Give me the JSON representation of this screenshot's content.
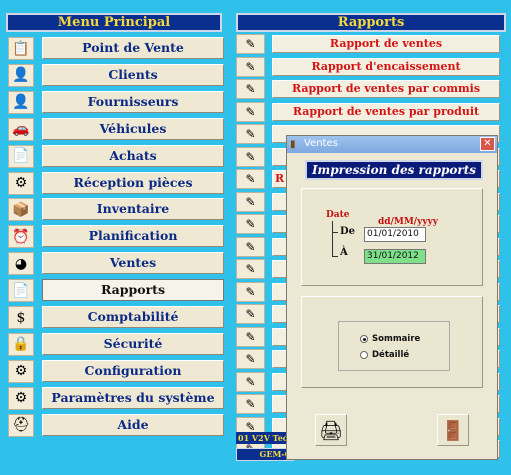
{
  "menu": {
    "title": "Menu Principal",
    "items": [
      {
        "label": "Point de Vente",
        "icon": "notepad-icon",
        "glyph": "📋"
      },
      {
        "label": "Clients",
        "icon": "person-icon",
        "glyph": "👤"
      },
      {
        "label": "Fournisseurs",
        "icon": "supplier-person-icon",
        "glyph": "👤"
      },
      {
        "label": "Véhicules",
        "icon": "car-icon",
        "glyph": "🚗"
      },
      {
        "label": "Achats",
        "icon": "purchase-document-icon",
        "glyph": "📄"
      },
      {
        "label": "Réception pièces",
        "icon": "parts-icon",
        "glyph": "⚙"
      },
      {
        "label": "Inventaire",
        "icon": "inventory-box-icon",
        "glyph": "📦"
      },
      {
        "label": "Planification",
        "icon": "clock-icon",
        "glyph": "⏰"
      },
      {
        "label": "Ventes",
        "icon": "pie-chart-icon",
        "glyph": "◕"
      },
      {
        "label": "Rapports",
        "icon": "report-document-icon",
        "glyph": "📄"
      },
      {
        "label": "Comptabilité",
        "icon": "dollar-icon",
        "glyph": "$"
      },
      {
        "label": "Sécurité",
        "icon": "lock-icon",
        "glyph": "🔒"
      },
      {
        "label": "Configuration",
        "icon": "configuration-icon",
        "glyph": "⚙"
      },
      {
        "label": "Paramètres du système",
        "icon": "system-settings-icon",
        "glyph": "⚙"
      },
      {
        "label": "Aide",
        "icon": "lifebuoy-icon",
        "glyph": "⛑"
      }
    ],
    "active_index": 9
  },
  "reports": {
    "title": "Rapports",
    "items": [
      {
        "label": "Rapport de ventes"
      },
      {
        "label": "Rapport d'encaissement"
      },
      {
        "label": "Rapport de ventes par commis"
      },
      {
        "label": "Rapport de ventes par produit"
      },
      {
        "label": ""
      },
      {
        "label": ""
      },
      {
        "label": "R"
      },
      {
        "label": ""
      },
      {
        "label": ""
      },
      {
        "label": ""
      },
      {
        "label": ""
      },
      {
        "label": ""
      },
      {
        "label": ""
      },
      {
        "label": ""
      },
      {
        "label": ""
      },
      {
        "label": ""
      },
      {
        "label": ""
      },
      {
        "label": ""
      },
      {
        "label": ""
      }
    ],
    "icon": "pencil-report-icon",
    "glyph": "✎"
  },
  "status": {
    "line1": "01 V2V Tec",
    "line2": "GEM-C"
  },
  "dialog": {
    "window_title": "Ventes",
    "heading": "Impression des rapports",
    "date_label": "Date",
    "format_label": "dd/MM/yyyy",
    "from_label": "De",
    "to_label": "À",
    "date_from": "01/01/2010",
    "date_to": "31/01/2012",
    "options": [
      {
        "label": "Sommaire",
        "checked": true
      },
      {
        "label": "Détaillé",
        "checked": false
      }
    ],
    "close_glyph": "✕",
    "print_glyph": "🖨",
    "exit_glyph": "🚪"
  }
}
